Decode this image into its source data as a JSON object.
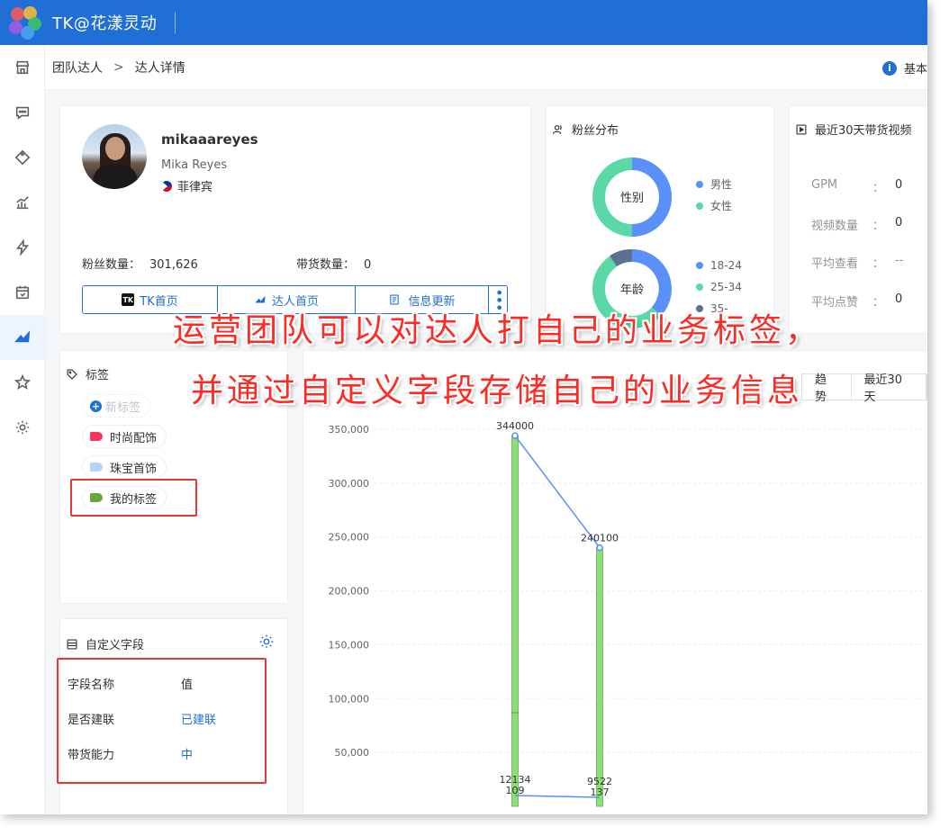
{
  "app": {
    "title": "TK@花漾灵动"
  },
  "sidebar": {
    "items": [
      {
        "icon": "store-icon"
      },
      {
        "icon": "chat-icon"
      },
      {
        "icon": "tag-icon"
      },
      {
        "icon": "chart-icon"
      },
      {
        "icon": "lightning-icon"
      },
      {
        "icon": "calendar-icon"
      },
      {
        "icon": "creator-icon",
        "active": true
      },
      {
        "icon": "star-icon"
      },
      {
        "icon": "gear-icon"
      }
    ]
  },
  "breadcrumb": {
    "items": [
      "团队达人",
      "达人详情"
    ],
    "separator": ">",
    "right_label": "基本"
  },
  "profile": {
    "username": "mikaaareyes",
    "display_name": "Mika Reyes",
    "country": "菲律宾",
    "fans_label": "粉丝数量：",
    "fans_value": "301,626",
    "goods_label": "带货数量：",
    "goods_value": "0",
    "buttons": [
      "TK首页",
      "达人首页",
      "信息更新"
    ],
    "tk_badge": "TK"
  },
  "fans": {
    "title": "粉丝分布",
    "gender_center": "性别",
    "gender_legend": [
      "男性",
      "女性"
    ],
    "gender_share": [
      0.5,
      0.5
    ],
    "age_center": "年龄",
    "age_legend": [
      "18-24",
      "25-34",
      "35-"
    ],
    "colors": {
      "blue": "#5b8ff9",
      "green": "#5ad8a6",
      "gray": "#5d7092"
    }
  },
  "video_stats": {
    "title": "最近30天带货视频",
    "rows": [
      {
        "label": "GPM",
        "value": "0"
      },
      {
        "label": "视频数量",
        "value": "0"
      },
      {
        "label": "平均查看",
        "value": "--"
      },
      {
        "label": "平均点赞",
        "value": "0"
      }
    ],
    "colon": "："
  },
  "tags": {
    "title": "标签",
    "new_label": "新标签",
    "items": [
      {
        "label": "时尚配饰",
        "color": "#f5365c"
      },
      {
        "label": "珠宝首饰",
        "color": "#b3d4f5"
      },
      {
        "label": "我的标签",
        "color": "#67a83e"
      }
    ]
  },
  "custom_fields": {
    "title": "自定义字段",
    "header": {
      "name": "字段名称",
      "value": "值"
    },
    "rows": [
      {
        "name": "是否建联",
        "value": "已建联"
      },
      {
        "name": "带货能力",
        "value": "中"
      }
    ]
  },
  "chart_tabs": [
    "趋势",
    "最近30天"
  ],
  "overlay": {
    "line1": "运营团队可以对达人打自己的业务标签，",
    "line2": "并通过自定义字段存储自己的业务信息"
  },
  "chart_data": {
    "type": "bar",
    "ylim": [
      0,
      350000
    ],
    "y_ticks": [
      "350,000",
      "300,000",
      "250,000",
      "200,000",
      "150,000",
      "100,000",
      "50,000"
    ],
    "bars": [
      344000,
      240100
    ],
    "line": [
      344000,
      240100
    ],
    "bottom_labels": [
      "12134",
      "109",
      "9522",
      "137"
    ],
    "bar_color": "#8fdc7a",
    "line_color": "#5b8ff9"
  }
}
